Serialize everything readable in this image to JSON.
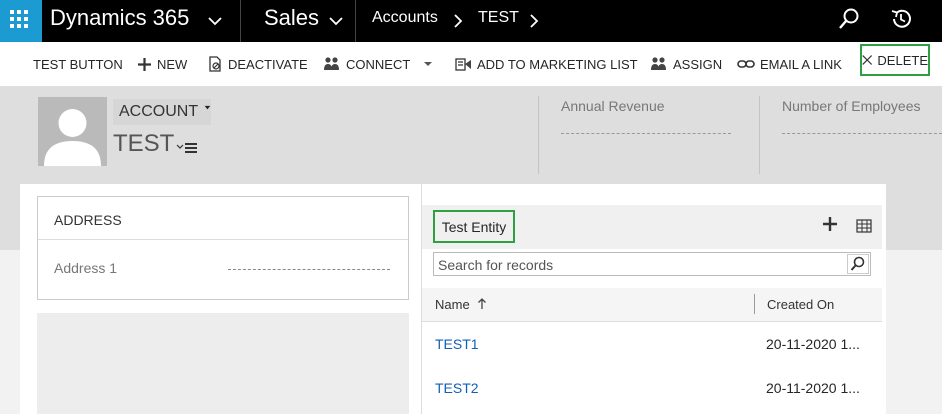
{
  "topnav": {
    "app_name": "Dynamics 365",
    "module": "Sales",
    "breadcrumb": [
      "Accounts",
      "TEST"
    ]
  },
  "commands": {
    "test_button": "TEST BUTTON",
    "new": "NEW",
    "deactivate": "DEACTIVATE",
    "connect": "CONNECT",
    "add_to_marketing_list": "ADD TO MARKETING LIST",
    "assign": "ASSIGN",
    "email_a_link": "EMAIL A LINK",
    "delete": "DELETE"
  },
  "header": {
    "entity_type": "ACCOUNT",
    "record_name": "TEST",
    "fields": [
      "Annual Revenue",
      "Number of Employees"
    ]
  },
  "address": {
    "title": "ADDRESS",
    "field_label": "Address 1"
  },
  "subgrid": {
    "title": "Test Entity",
    "search_placeholder": "Search for records",
    "columns": [
      "Name",
      "Created On"
    ],
    "rows": [
      {
        "name": "TEST1",
        "created_on": "20-11-2020 1..."
      },
      {
        "name": "TEST2",
        "created_on": "20-11-2020 1..."
      }
    ]
  },
  "colors": {
    "nav_bg": "#000000",
    "waffle_bg": "#1b9bd1",
    "highlight": "#2ea043",
    "link": "#1160b7"
  }
}
